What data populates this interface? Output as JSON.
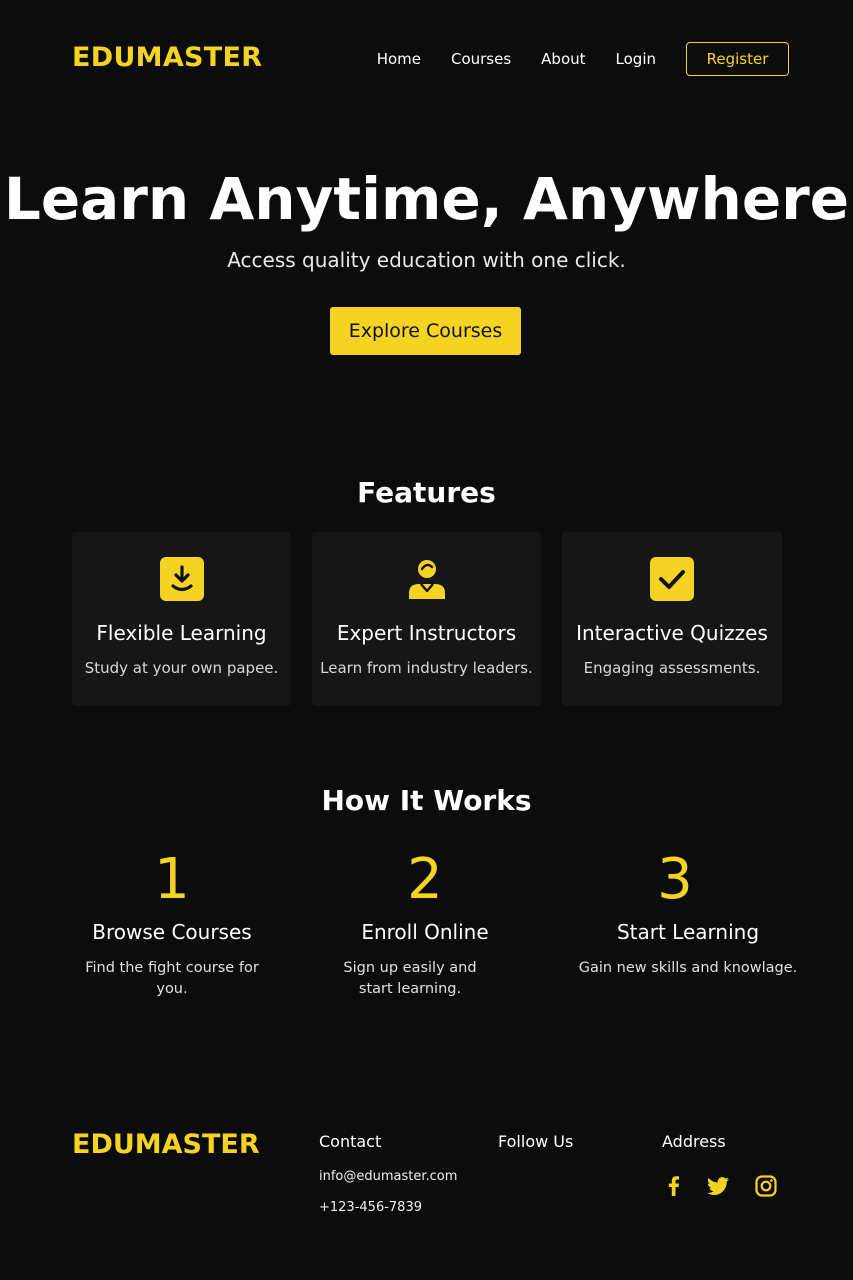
{
  "brand": {
    "name": "EDUMASTER",
    "accent_color": "#f5d322",
    "background_color": "#0c0c0c"
  },
  "nav": {
    "links": [
      "Home",
      "Courses",
      "About",
      "Login"
    ],
    "register_label": "Register"
  },
  "hero": {
    "title": "Learn Anytime, Anywhere",
    "subtitle": "Access quality education with one click.",
    "cta_label": "Explore Courses"
  },
  "features": {
    "heading": "Features",
    "items": [
      {
        "icon": "download-icon",
        "title": "Flexible Learning",
        "description": "Study at your own papee."
      },
      {
        "icon": "instructor-icon",
        "title": "Expert Instructors",
        "description": "Learn from industry leaders."
      },
      {
        "icon": "checkbox-icon",
        "title": "Interactive Quizzes",
        "description": "Engaging assessments."
      }
    ]
  },
  "how_it_works": {
    "heading": "How It Works",
    "steps": [
      {
        "number": "1",
        "title": "Browse Courses",
        "description": "Find the fight course for you."
      },
      {
        "number": "2",
        "title": "Enroll Online",
        "description": "Sign up easily and start learning."
      },
      {
        "number": "3",
        "title": "Start Learning",
        "description": "Gain new skills and knowlage."
      }
    ]
  },
  "footer": {
    "logo": "EDUMASTER",
    "contact_heading": "Contact",
    "email": "info@edumaster.com",
    "phone": "+123-456-7839",
    "follow_heading": "Follow Us",
    "address_heading": "Address",
    "social_icons": [
      "facebook-icon",
      "twitter-icon",
      "instagram-icon"
    ]
  }
}
